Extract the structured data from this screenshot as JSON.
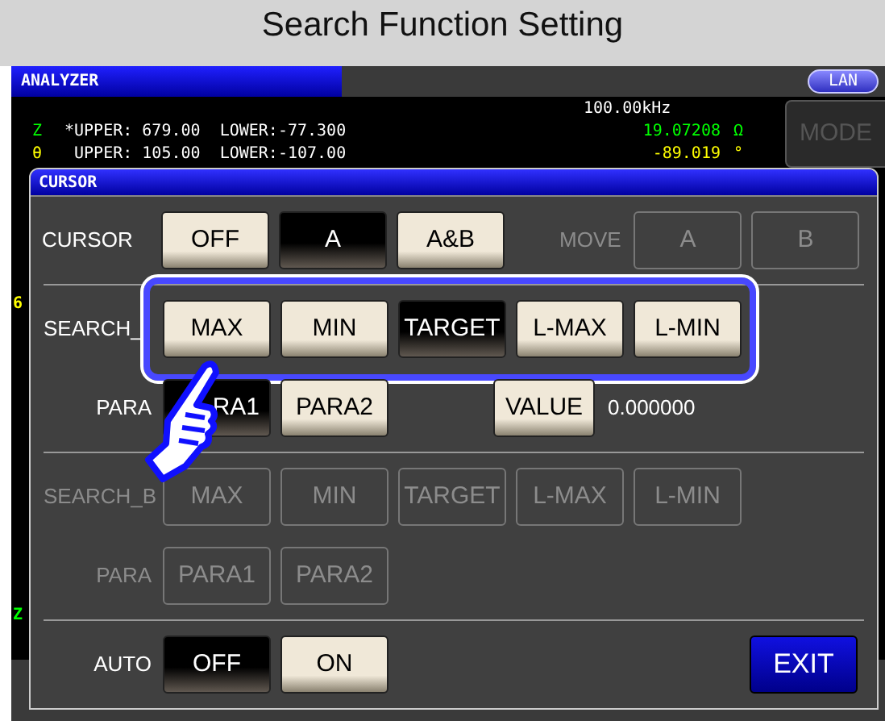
{
  "title": "Search Function Setting",
  "analyzer": {
    "title": "ANALYZER",
    "lan": "LAN",
    "frequency": "100.00kHz",
    "mode": "MODE",
    "lines": [
      {
        "param": "Z",
        "limits": "*UPPER: 679.00  LOWER:-77.300",
        "reading": "19.07208",
        "unit": "Ω",
        "color": "#00ff00"
      },
      {
        "param": "θ",
        "limits": " UPPER: 105.00  LOWER:-107.00",
        "reading": "-89.019",
        "unit": "°",
        "color": "#ffff00"
      }
    ],
    "side_marks": [
      {
        "text": "6",
        "color": "#ffff00"
      },
      {
        "text": "Z",
        "color": "#00ff00"
      }
    ]
  },
  "dialog": {
    "title": "CURSOR",
    "exit": "EXIT",
    "sections": [
      {
        "rows": [
          {
            "label": "CURSOR",
            "kind": "main",
            "disabled": false,
            "highlighted": false,
            "buttons": [
              {
                "label": "OFF",
                "selected": false
              },
              {
                "label": "A",
                "selected": true
              },
              {
                "label": "A&B",
                "selected": false
              }
            ],
            "move": {
              "label": "MOVE",
              "disabled": true,
              "buttons": [
                {
                  "label": "A",
                  "selected": false
                },
                {
                  "label": "B",
                  "selected": false
                }
              ]
            }
          }
        ]
      },
      {
        "rows": [
          {
            "label": "SEARCH_",
            "kind": "main",
            "disabled": false,
            "highlighted": true,
            "buttons": [
              {
                "label": "MAX",
                "selected": false
              },
              {
                "label": "MIN",
                "selected": false
              },
              {
                "label": "TARGET",
                "selected": true
              },
              {
                "label": "L-MAX",
                "selected": false
              },
              {
                "label": "L-MIN",
                "selected": false
              }
            ]
          },
          {
            "label": "PARA",
            "kind": "sub",
            "disabled": false,
            "highlighted": false,
            "buttons": [
              {
                "label": "RA1",
                "selected": true
              },
              {
                "label": "PARA2",
                "selected": false
              }
            ],
            "value_button": "VALUE",
            "value": "0.000000"
          }
        ]
      },
      {
        "rows": [
          {
            "label": "SEARCH_B",
            "kind": "main",
            "disabled": true,
            "highlighted": false,
            "buttons": [
              {
                "label": "MAX",
                "selected": false
              },
              {
                "label": "MIN",
                "selected": false
              },
              {
                "label": "TARGET",
                "selected": false
              },
              {
                "label": "L-MAX",
                "selected": false
              },
              {
                "label": "L-MIN",
                "selected": false
              }
            ]
          },
          {
            "label": "PARA",
            "kind": "sub",
            "disabled": true,
            "highlighted": false,
            "buttons": [
              {
                "label": "PARA1",
                "selected": false
              },
              {
                "label": "PARA2",
                "selected": false
              }
            ]
          }
        ]
      },
      {
        "rows": [
          {
            "label": "AUTO",
            "kind": "sub",
            "disabled": false,
            "highlighted": false,
            "buttons": [
              {
                "label": "OFF",
                "selected": true
              },
              {
                "label": "ON",
                "selected": false
              }
            ]
          }
        ]
      }
    ]
  }
}
